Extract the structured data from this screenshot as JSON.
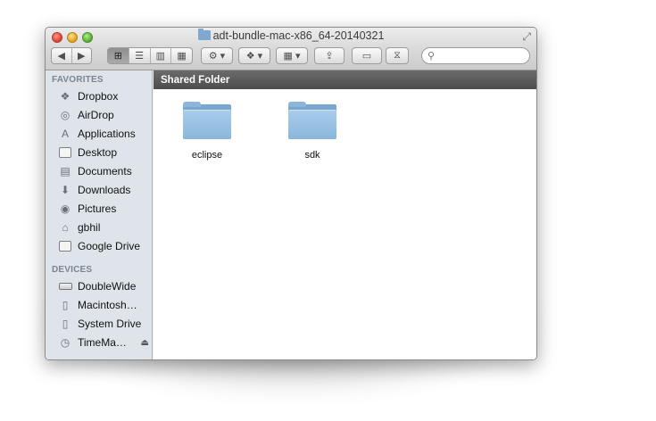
{
  "window": {
    "title": "adt-bundle-mac-x86_64-20140321",
    "fullscreen_icon": "fullscreen-arrows-icon"
  },
  "toolbar": {
    "back_icon": "back-arrow-icon",
    "forward_icon": "forward-arrow-icon",
    "view_modes": [
      "icon-view",
      "list-view",
      "column-view",
      "coverflow-view"
    ],
    "active_view": "icon-view",
    "action_icon": "gear-icon",
    "dropbox_icon": "dropbox-icon",
    "arrange_icon": "grid-icon",
    "share_icon": "share-icon",
    "tags_icon": "tag-icon",
    "extra_icon": "hourglass-icon",
    "search": {
      "placeholder": "",
      "value": ""
    }
  },
  "sidebar": {
    "favorites_header": "FAVORITES",
    "favorites": [
      {
        "label": "Dropbox",
        "icon": "dropbox-icon"
      },
      {
        "label": "AirDrop",
        "icon": "airdrop-icon"
      },
      {
        "label": "Applications",
        "icon": "applications-icon"
      },
      {
        "label": "Desktop",
        "icon": "desktop-icon"
      },
      {
        "label": "Documents",
        "icon": "documents-icon"
      },
      {
        "label": "Downloads",
        "icon": "downloads-icon"
      },
      {
        "label": "Pictures",
        "icon": "pictures-icon"
      },
      {
        "label": "gbhil",
        "icon": "home-icon"
      },
      {
        "label": "Google Drive",
        "icon": "folder-icon"
      }
    ],
    "devices_header": "DEVICES",
    "devices": [
      {
        "label": "DoubleWide",
        "icon": "disk-icon"
      },
      {
        "label": "Macintosh…",
        "icon": "hard-drive-icon"
      },
      {
        "label": "System Drive",
        "icon": "hard-drive-icon"
      },
      {
        "label": "TimeMa…",
        "icon": "time-machine-icon",
        "eject": true
      }
    ]
  },
  "main": {
    "path_label": "Shared Folder",
    "items": [
      {
        "name": "eclipse",
        "type": "folder"
      },
      {
        "name": "sdk",
        "type": "folder"
      }
    ]
  },
  "colors": {
    "sidebar_bg": "#dfe4ea",
    "pathbar_bg": "#5a5a5a",
    "folder_blue": "#8ab6dc"
  }
}
